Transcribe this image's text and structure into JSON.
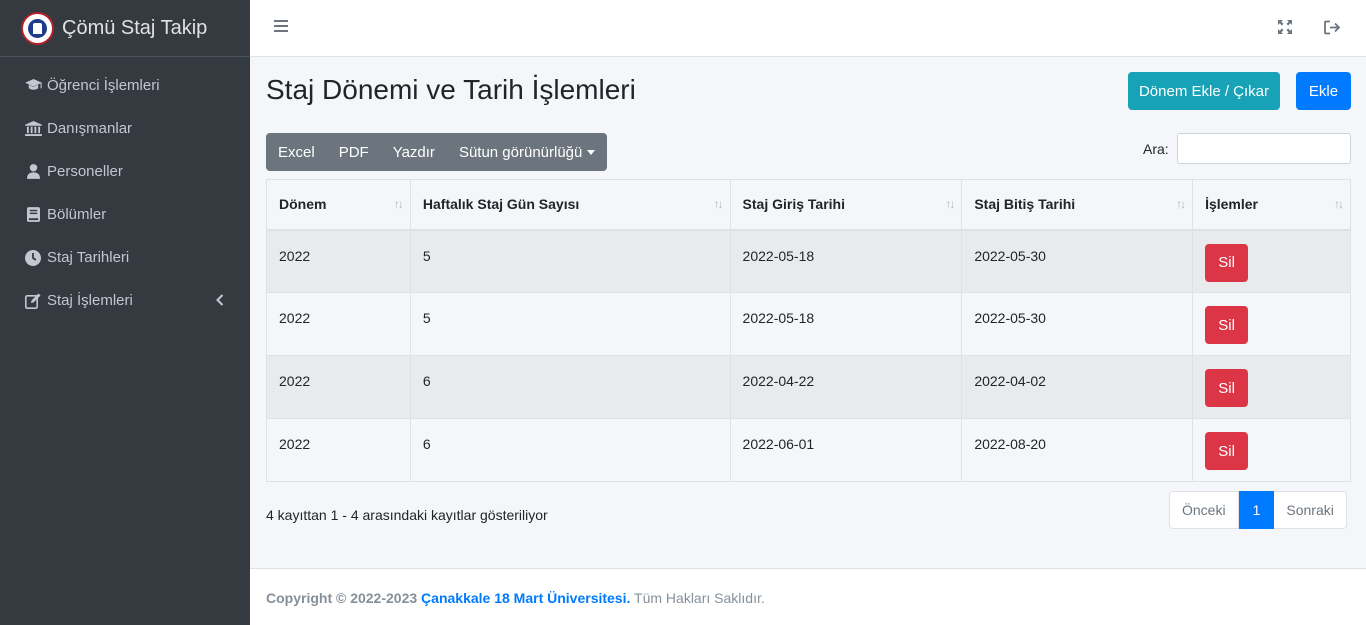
{
  "brand": {
    "title": "Çömü Staj Takip"
  },
  "sidebar": {
    "items": [
      {
        "label": "Öğrenci İşlemleri",
        "icon": "graduation-cap-icon"
      },
      {
        "label": "Danışmanlar",
        "icon": "university-icon"
      },
      {
        "label": "Personeller",
        "icon": "user-icon"
      },
      {
        "label": "Bölümler",
        "icon": "book-icon"
      },
      {
        "label": "Staj Tarihleri",
        "icon": "clock-icon"
      },
      {
        "label": "Staj İşlemleri",
        "icon": "edit-icon"
      }
    ]
  },
  "page": {
    "title": "Staj Dönemi ve Tarih İşlemleri",
    "btn_donem": "Dönem Ekle / Çıkar",
    "btn_ekle": "Ekle"
  },
  "toolbar": {
    "excel": "Excel",
    "pdf": "PDF",
    "yazdir": "Yazdır",
    "columns": "Sütun görünürlüğü"
  },
  "search": {
    "label": "Ara:",
    "value": ""
  },
  "table": {
    "headers": [
      "Dönem",
      "Haftalık Staj Gün Sayısı",
      "Staj Giriş Tarihi",
      "Staj Bitiş Tarihi",
      "İşlemler"
    ],
    "rows": [
      {
        "donem": "2022",
        "gun": "5",
        "giris": "2022-05-18",
        "bitis": "2022-05-30",
        "action": "Sil"
      },
      {
        "donem": "2022",
        "gun": "5",
        "giris": "2022-05-18",
        "bitis": "2022-05-30",
        "action": "Sil"
      },
      {
        "donem": "2022",
        "gun": "6",
        "giris": "2022-04-22",
        "bitis": "2022-04-02",
        "action": "Sil"
      },
      {
        "donem": "2022",
        "gun": "6",
        "giris": "2022-06-01",
        "bitis": "2022-08-20",
        "action": "Sil"
      }
    ]
  },
  "info": "4 kayıttan 1 - 4 arasındaki kayıtlar gösteriliyor",
  "pagination": {
    "prev": "Önceki",
    "current": "1",
    "next": "Sonraki"
  },
  "footer": {
    "copyright": "Copyright © 2022-2023",
    "org": "Çanakkale 18 Mart Üniversitesi.",
    "rights": "Tüm Hakları Saklıdır."
  },
  "colors": {
    "sidebar": "#343a40",
    "info": "#17a2b8",
    "primary": "#007bff",
    "danger": "#dc3545",
    "secondary": "#6c757d"
  }
}
